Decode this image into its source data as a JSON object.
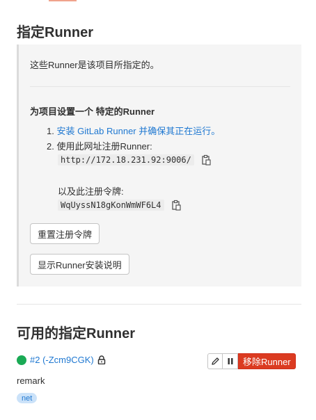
{
  "section": {
    "title": "指定Runner",
    "intro": "这些Runner是该项目所指定的。",
    "setup_title": "为项目设置一个 特定的Runner",
    "step1_num": "1.",
    "step1_link": "安装 GitLab Runner 并确保其正在运行。",
    "step2_num": "2.",
    "step2_text": "使用此网址注册Runner:",
    "url": "http://172.18.231.92:9006/",
    "token_label": "以及此注册令牌:",
    "token": "WqUyssN18gKonWmWF6L4",
    "reset_button": "重置注册令牌",
    "show_button": "显示Runner安装说明"
  },
  "available": {
    "title": "可用的指定Runner",
    "runner": {
      "id_text": "#2 (-Zcm9CGK)",
      "status_color": "#1aaa55",
      "description": "remark",
      "tag": "net",
      "remove_label": "移除Runner",
      "edit_icon": "pencil-icon",
      "pause_icon": "pause-icon"
    }
  },
  "colors": {
    "link": "#1f78d1",
    "danger": "#db3b21",
    "tag_bg": "#cbe2f9"
  }
}
